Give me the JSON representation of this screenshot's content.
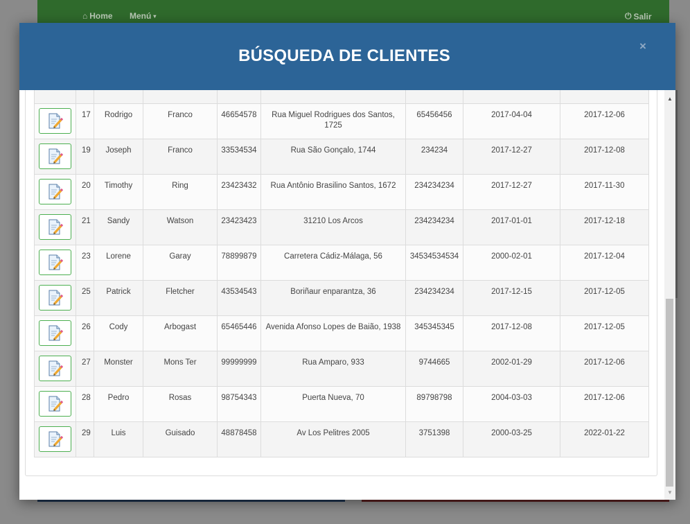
{
  "background_nav": {
    "home": "Home",
    "menu": "Menú",
    "salir": "Salir"
  },
  "modal": {
    "title": "BÚSQUEDA DE CLIENTES",
    "close": "×"
  },
  "clients": [
    {
      "id": "17",
      "name": "Rodrigo",
      "last": "Franco",
      "doc": "46654578",
      "address": "Rua Miguel Rodrigues dos Santos, 1725",
      "phone": "65456456",
      "date1": "2017-04-04",
      "date2": "2017-12-06"
    },
    {
      "id": "19",
      "name": "Joseph",
      "last": "Franco",
      "doc": "33534534",
      "address": "Rua São Gonçalo, 1744",
      "phone": "234234",
      "date1": "2017-12-27",
      "date2": "2017-12-08"
    },
    {
      "id": "20",
      "name": "Timothy",
      "last": "Ring",
      "doc": "23423432",
      "address": "Rua Antônio Brasilino Santos, 1672",
      "phone": "234234234",
      "date1": "2017-12-27",
      "date2": "2017-11-30"
    },
    {
      "id": "21",
      "name": "Sandy",
      "last": "Watson",
      "doc": "23423423",
      "address": "31210 Los Arcos",
      "phone": "234234234",
      "date1": "2017-01-01",
      "date2": "2017-12-18"
    },
    {
      "id": "23",
      "name": "Lorene",
      "last": "Garay",
      "doc": "78899879",
      "address": "Carretera Cádiz-Málaga, 56",
      "phone": "34534534534",
      "date1": "2000-02-01",
      "date2": "2017-12-04"
    },
    {
      "id": "25",
      "name": "Patrick",
      "last": "Fletcher",
      "doc": "43534543",
      "address": "Boriñaur enparantza, 36",
      "phone": "234234234",
      "date1": "2017-12-15",
      "date2": "2017-12-05"
    },
    {
      "id": "26",
      "name": "Cody",
      "last": "Arbogast",
      "doc": "65465446",
      "address": "Avenida Afonso Lopes de Baião, 1938",
      "phone": "345345345",
      "date1": "2017-12-08",
      "date2": "2017-12-05"
    },
    {
      "id": "27",
      "name": "Monster",
      "last": "Mons Ter",
      "doc": "99999999",
      "address": "Rua Amparo, 933",
      "phone": "9744665",
      "date1": "2002-01-29",
      "date2": "2017-12-06"
    },
    {
      "id": "28",
      "name": "Pedro",
      "last": "Rosas",
      "doc": "98754343",
      "address": "Puerta Nueva, 70",
      "phone": "89798798",
      "date1": "2004-03-03",
      "date2": "2017-12-06"
    },
    {
      "id": "29",
      "name": "Luis",
      "last": "Guisado",
      "doc": "48878458",
      "address": "Av Los Pelitres 2005",
      "phone": "3751398",
      "date1": "2000-03-25",
      "date2": "2022-01-22"
    }
  ],
  "icons": {
    "edit": "edit-document-icon",
    "home": "home-icon",
    "power": "power-icon"
  },
  "colors": {
    "header": "#2c6497",
    "navbar": "#2f6a2c",
    "button_border": "#4caf50"
  }
}
